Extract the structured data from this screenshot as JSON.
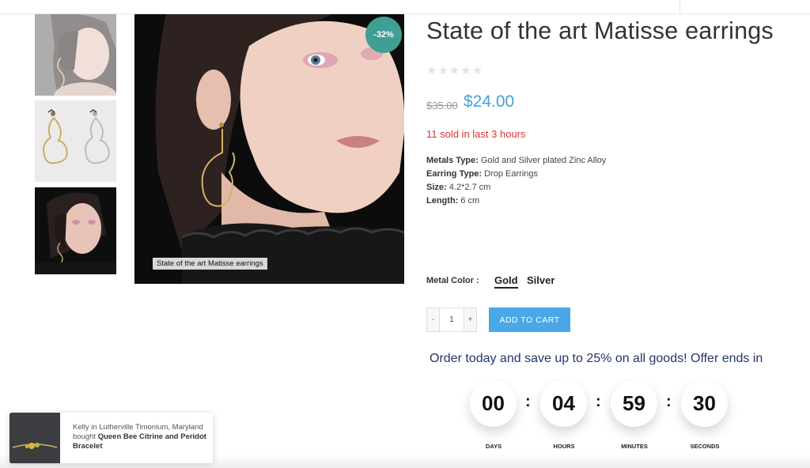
{
  "product": {
    "title": "State of the art Matisse earrings",
    "rating_stars": 0,
    "old_price": "$35.00",
    "new_price": "$24.00",
    "sold_text": "11 sold in last 3 hours",
    "discount_badge": "-32%",
    "image_caption": "State of the art Matisse earrings",
    "specs": [
      {
        "label": "Metals Type:",
        "value": " Gold and Silver plated Zinc Alloy"
      },
      {
        "label": "Earring Type:",
        "value": " Drop Earrings"
      },
      {
        "label": "Size:",
        "value": " 4.2*2.7 cm"
      },
      {
        "label": "Length:",
        "value": " 6 cm"
      }
    ]
  },
  "variant": {
    "label": "Metal Color :",
    "options": [
      "Gold",
      "Silver"
    ],
    "selected": "Gold"
  },
  "cart": {
    "minus": "-",
    "quantity": "1",
    "plus": "+",
    "add_label": "ADD TO CART"
  },
  "promo_text": "Order today and save up to 25% on all goods! Offer ends in",
  "countdown": {
    "days": "00",
    "hours": "04",
    "minutes": "59",
    "seconds": "30",
    "labels": {
      "days": "DAYS",
      "hours": "HOURS",
      "minutes": "MINUTES",
      "seconds": "SECONDS"
    },
    "separator": ":"
  },
  "notification": {
    "text": "Kelly in Lutherville Timonium, Maryland bought ",
    "product": "Queen Bee Citrine and Peridot Bracelet"
  },
  "colors": {
    "price": "#4a9fd8",
    "sold": "#dd3333",
    "badge": "#3f9f94",
    "button": "#4aa8e8",
    "promo": "#27336b"
  },
  "icons": [
    "star-icon"
  ]
}
